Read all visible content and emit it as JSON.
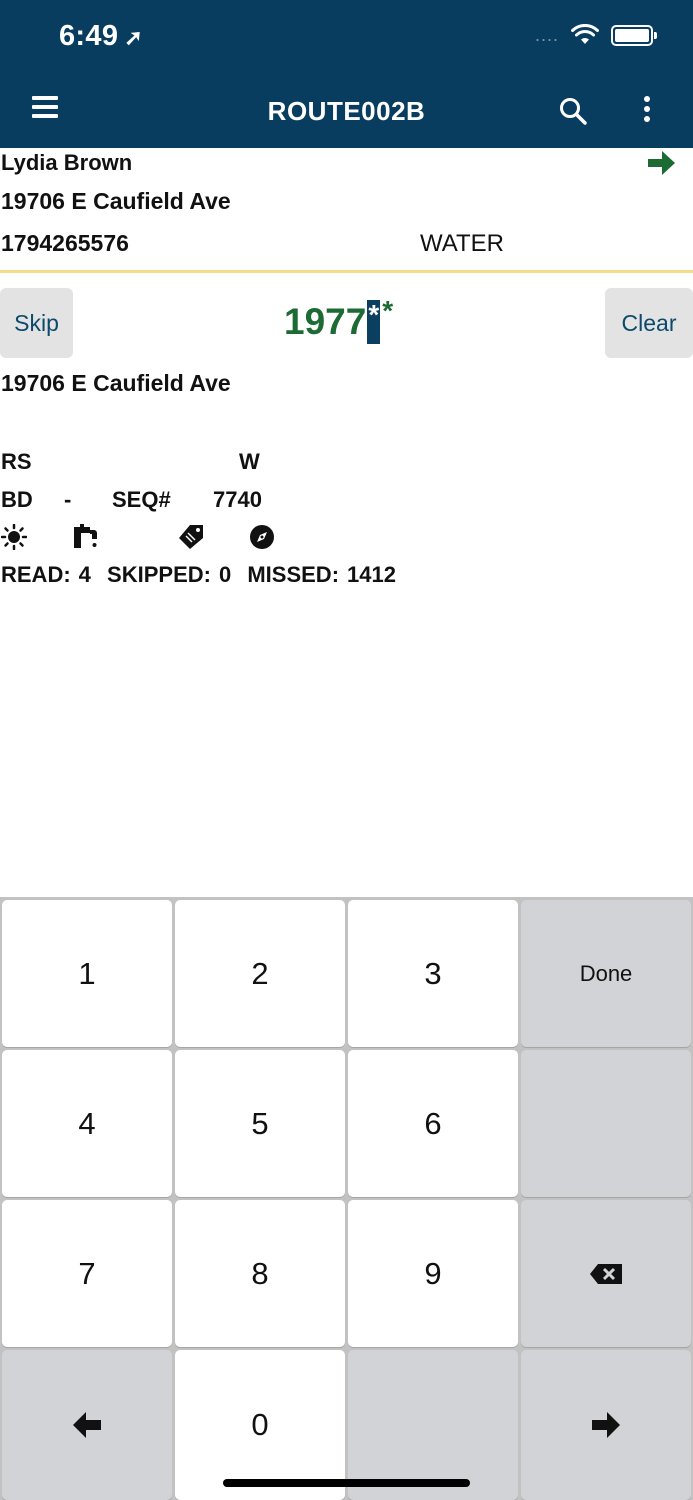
{
  "status_bar": {
    "time": "6:49",
    "location_glyph": "➚",
    "signal": "....",
    "wifi_icon": "wifi-icon",
    "battery_icon": "battery-icon"
  },
  "app_bar": {
    "title": "ROUTE002B",
    "menu_icon": "hamburger-menu-icon",
    "search_icon": "search-icon",
    "more_icon": "more-vertical-icon",
    "background": "#083d5f"
  },
  "customer": {
    "name": "Lydia Brown",
    "address": "19706 E Caufield Ave",
    "account": "1794265576",
    "service": "WATER",
    "next_icon": "arrow-right-icon",
    "next_icon_color": "#1c6b34"
  },
  "reading": {
    "skip_label": "Skip",
    "clear_label": "Clear",
    "entered": "1977",
    "cursor_char": "*",
    "trailing_mask": "*",
    "reading_color": "#1c6b34"
  },
  "meter": {
    "address": "19706 E Caufield Ave",
    "rs_label": "RS",
    "w_label": "W",
    "bd_label": "BD",
    "dash": "-",
    "seq_label": "SEQ#",
    "seq_value": "7740",
    "icons": [
      "sun-icon",
      "faucet-icon",
      "tag-icon",
      "compass-icon"
    ]
  },
  "stats": {
    "read_label": "READ:",
    "read_value": "4",
    "skipped_label": "SKIPPED:",
    "skipped_value": "0",
    "missed_label": "MISSED:",
    "missed_value": "1412"
  },
  "keypad": {
    "keys": [
      "1",
      "2",
      "3",
      "4",
      "5",
      "6",
      "7",
      "8",
      "9",
      "0"
    ],
    "done_label": "Done",
    "backspace_icon": "backspace-icon",
    "left_icon": "arrow-left-icon",
    "right_icon": "arrow-right-icon"
  }
}
